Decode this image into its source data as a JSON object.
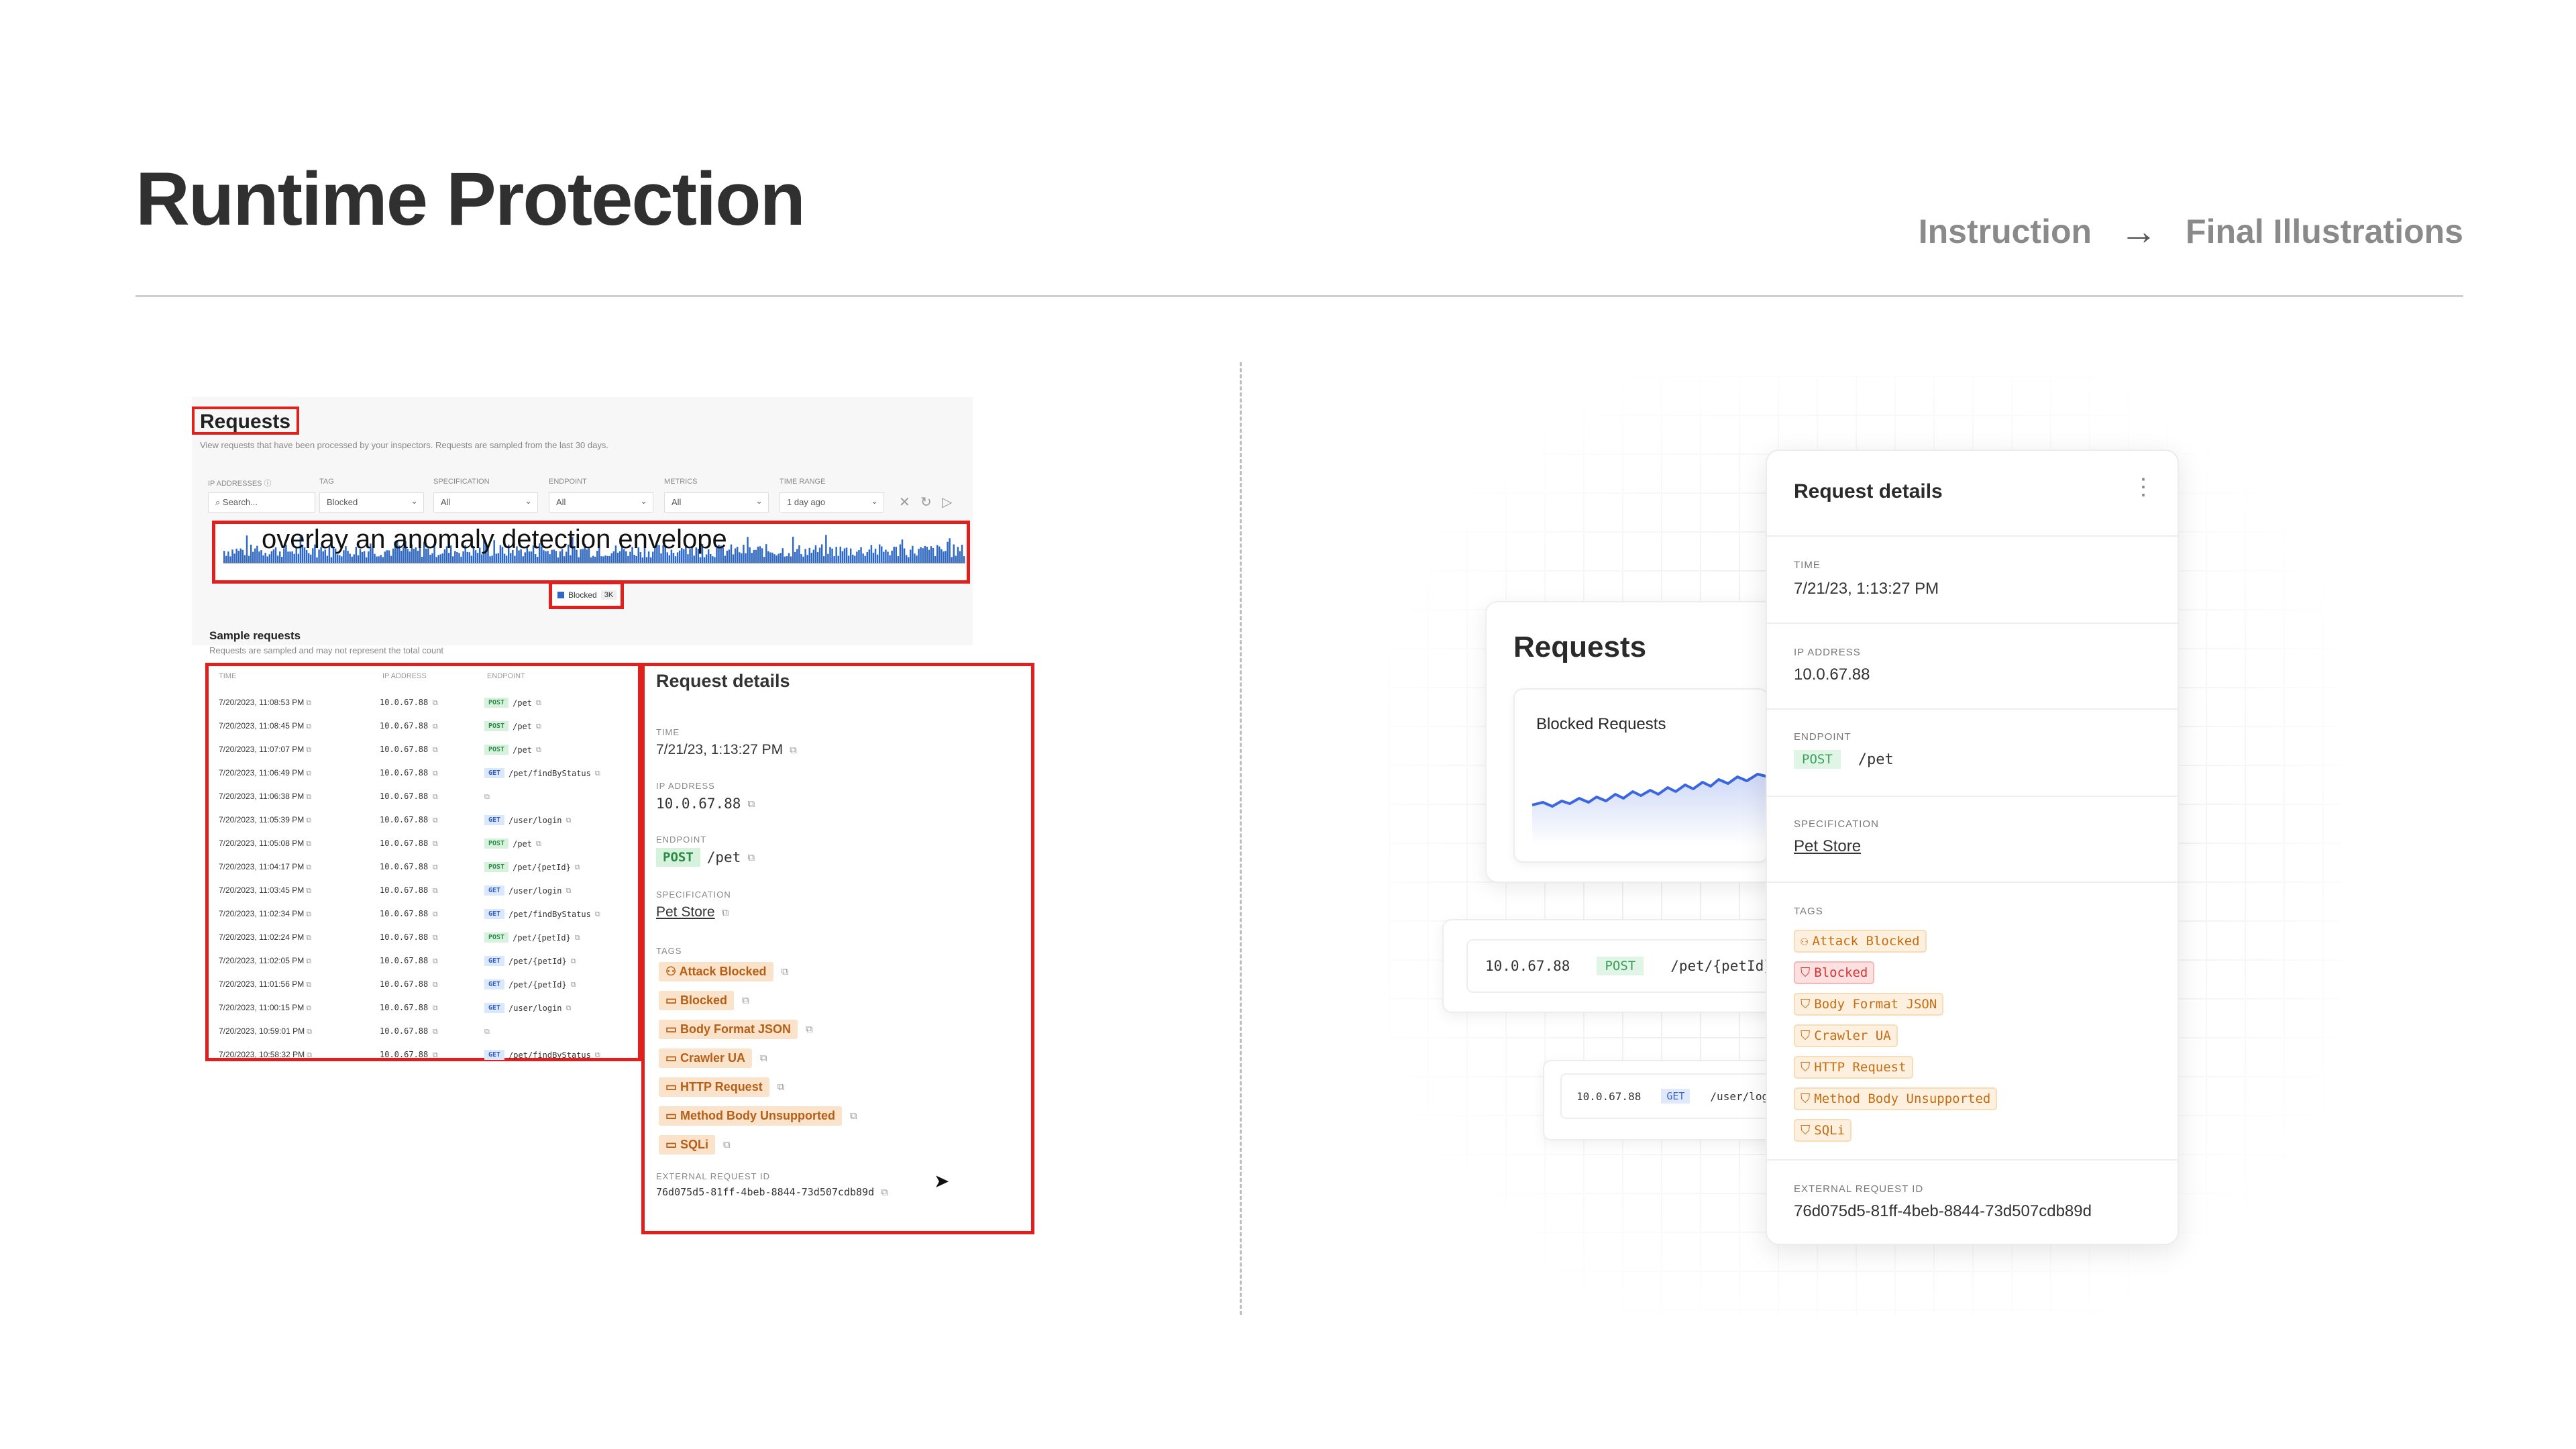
{
  "header": {
    "title": "Runtime Protection",
    "crumb_from": "Instruction",
    "crumb_to": "Final Illustrations"
  },
  "instruction": {
    "requests_title": "Requests",
    "requests_subtitle": "View requests that have been processed by your inspectors. Requests are sampled from the last 30 days.",
    "filters": [
      {
        "label": "IP ADDRESSES ⓘ",
        "value": "Search...",
        "is_search": true
      },
      {
        "label": "TAG",
        "value": "Blocked"
      },
      {
        "label": "SPECIFICATION",
        "value": "All"
      },
      {
        "label": "ENDPOINT",
        "value": "All"
      },
      {
        "label": "METRICS",
        "value": "All"
      },
      {
        "label": "TIME RANGE",
        "value": "1 day ago"
      }
    ],
    "annotation": "overlay an anomaly detection envelope",
    "legend": {
      "label": "Blocked",
      "count": "3K"
    },
    "sample_title": "Sample requests",
    "sample_subtitle": "Requests are sampled and may not represent the total count",
    "table_headers": [
      "TIME",
      "IP ADDRESS",
      "ENDPOINT"
    ],
    "rows": [
      {
        "time": "7/20/2023, 11:08:53 PM",
        "ip": "10.0.67.88",
        "method": "POST",
        "path": "/pet"
      },
      {
        "time": "7/20/2023, 11:08:45 PM",
        "ip": "10.0.67.88",
        "method": "POST",
        "path": "/pet"
      },
      {
        "time": "7/20/2023, 11:07:07 PM",
        "ip": "10.0.67.88",
        "method": "POST",
        "path": "/pet"
      },
      {
        "time": "7/20/2023, 11:06:49 PM",
        "ip": "10.0.67.88",
        "method": "GET",
        "path": "/pet/findByStatus"
      },
      {
        "time": "7/20/2023, 11:06:38 PM",
        "ip": "10.0.67.88",
        "method": "",
        "path": ""
      },
      {
        "time": "7/20/2023, 11:05:39 PM",
        "ip": "10.0.67.88",
        "method": "GET",
        "path": "/user/login"
      },
      {
        "time": "7/20/2023, 11:05:08 PM",
        "ip": "10.0.67.88",
        "method": "POST",
        "path": "/pet"
      },
      {
        "time": "7/20/2023, 11:04:17 PM",
        "ip": "10.0.67.88",
        "method": "POST",
        "path": "/pet/{petId}"
      },
      {
        "time": "7/20/2023, 11:03:45 PM",
        "ip": "10.0.67.88",
        "method": "GET",
        "path": "/user/login"
      },
      {
        "time": "7/20/2023, 11:02:34 PM",
        "ip": "10.0.67.88",
        "method": "GET",
        "path": "/pet/findByStatus"
      },
      {
        "time": "7/20/2023, 11:02:24 PM",
        "ip": "10.0.67.88",
        "method": "POST",
        "path": "/pet/{petId}"
      },
      {
        "time": "7/20/2023, 11:02:05 PM",
        "ip": "10.0.67.88",
        "method": "GET",
        "path": "/pet/{petId}"
      },
      {
        "time": "7/20/2023, 11:01:56 PM",
        "ip": "10.0.67.88",
        "method": "GET",
        "path": "/pet/{petId}"
      },
      {
        "time": "7/20/2023, 11:00:15 PM",
        "ip": "10.0.67.88",
        "method": "GET",
        "path": "/user/login"
      },
      {
        "time": "7/20/2023, 10:59:01 PM",
        "ip": "10.0.67.88",
        "method": "",
        "path": ""
      },
      {
        "time": "7/20/2023, 10:58:32 PM",
        "ip": "10.0.67.88",
        "method": "GET",
        "path": "/pet/findByStatus"
      }
    ],
    "details": {
      "title": "Request details",
      "time_label": "TIME",
      "time": "7/21/23, 1:13:27 PM",
      "ip_label": "IP ADDRESS",
      "ip": "10.0.67.88",
      "endpoint_label": "ENDPOINT",
      "method": "POST",
      "path": "/pet",
      "spec_label": "SPECIFICATION",
      "spec": "Pet Store",
      "tags_label": "TAGS",
      "tags": [
        "Attack Blocked",
        "Blocked",
        "Body Format JSON",
        "Crawler UA",
        "HTTP Request",
        "Method Body Unsupported",
        "SQLi"
      ],
      "ext_label": "EXTERNAL REQUEST ID",
      "ext_id": "76d075d5-81ff-4beb-8844-73d507cdb89d"
    }
  },
  "final": {
    "requests_title": "Requests",
    "blocked_title": "Blocked Requests",
    "row1": {
      "ip": "10.0.67.88",
      "method": "POST",
      "path": "/pet/{petId}"
    },
    "row2": {
      "ip": "10.0.67.88",
      "method": "GET",
      "path": "/user/log"
    },
    "details": {
      "title": "Request details",
      "kebab": "⋮",
      "time_label": "TIME",
      "time": "7/21/23, 1:13:27 PM",
      "ip_label": "IP ADDRESS",
      "ip": "10.0.67.88",
      "endpoint_label": "ENDPOINT",
      "method": "POST",
      "path": "/pet",
      "spec_label": "SPECIFICATION",
      "spec": "Pet Store",
      "tags_label": "TAGS",
      "tags": [
        "Attack Blocked",
        "Blocked",
        "Body Format JSON",
        "Crawler UA",
        "HTTP Request",
        "Method Body Unsupported",
        "SQLi"
      ],
      "ext_label": "EXTERNAL REQUEST ID",
      "ext_id": "76d075d5-81ff-4beb-8844-73d507cdb89d"
    }
  },
  "colors": {
    "annotation_box": "#e0201c",
    "bar_blue": "#2d68c4",
    "tag_orange": "#c66d14",
    "tag_red": "#d23434"
  }
}
